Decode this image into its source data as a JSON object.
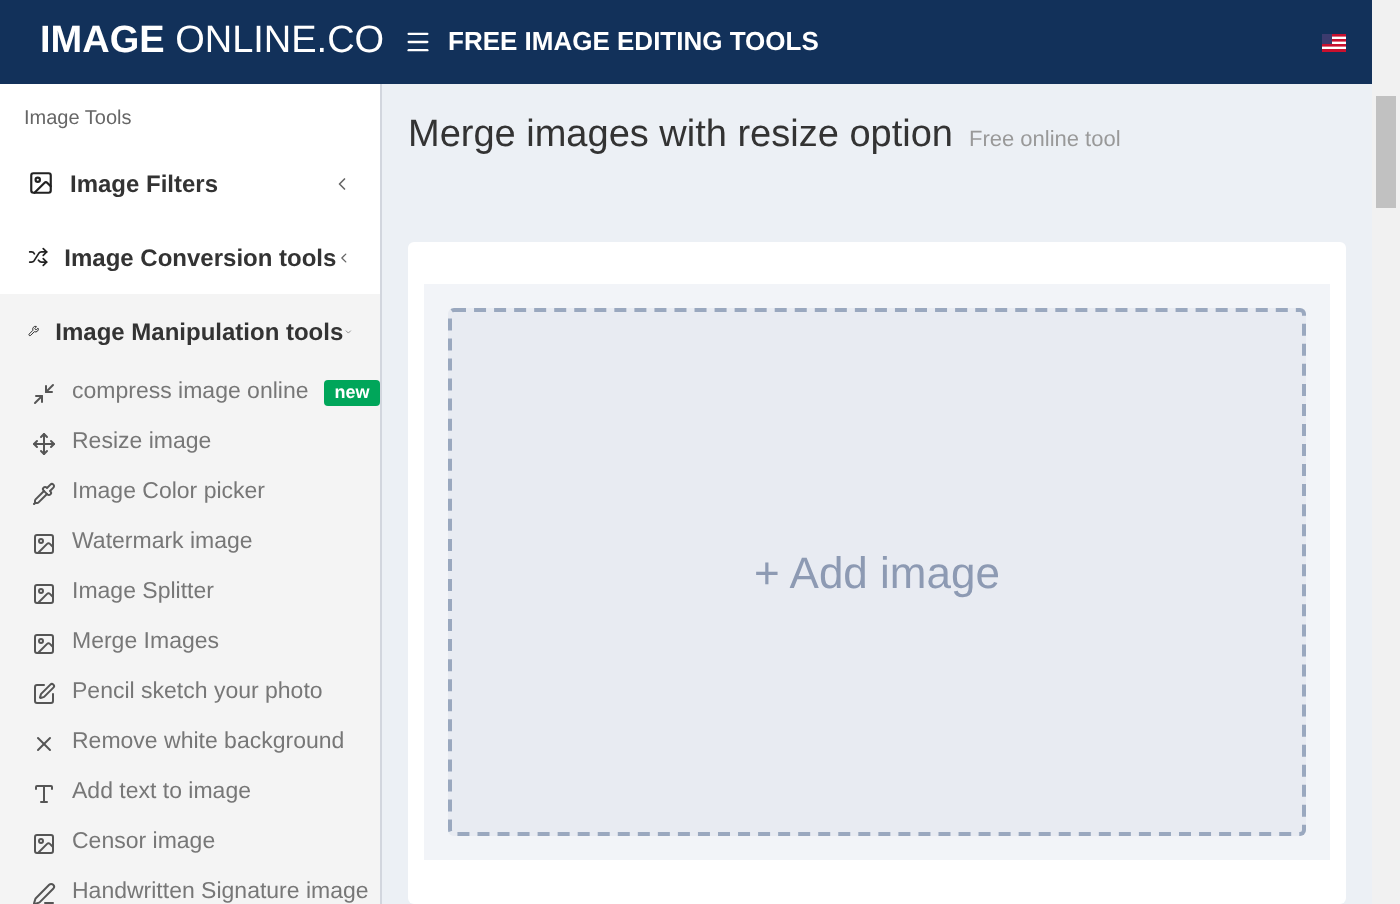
{
  "header": {
    "logo_bold": "IMAGE",
    "logo_rest": "ONLINE.CO",
    "title": "FREE IMAGE EDITING TOOLS"
  },
  "sidebar": {
    "heading": "Image Tools",
    "groups": [
      {
        "label": "Image Filters",
        "expanded": false
      },
      {
        "label": "Image Conversion tools",
        "expanded": false
      },
      {
        "label": "Image Manipulation tools",
        "expanded": true,
        "children": [
          {
            "label": "compress image online",
            "badge": "new"
          },
          {
            "label": "Resize image"
          },
          {
            "label": "Image Color picker"
          },
          {
            "label": "Watermark image"
          },
          {
            "label": "Image Splitter"
          },
          {
            "label": "Merge Images"
          },
          {
            "label": "Pencil sketch your photo"
          },
          {
            "label": "Remove white background"
          },
          {
            "label": "Add text to image"
          },
          {
            "label": "Censor image"
          },
          {
            "label": "Handwritten Signature image"
          }
        ]
      }
    ]
  },
  "main": {
    "title": "Merge images with resize option",
    "subtitle": "Free online tool",
    "dropzone": "+ Add image"
  }
}
